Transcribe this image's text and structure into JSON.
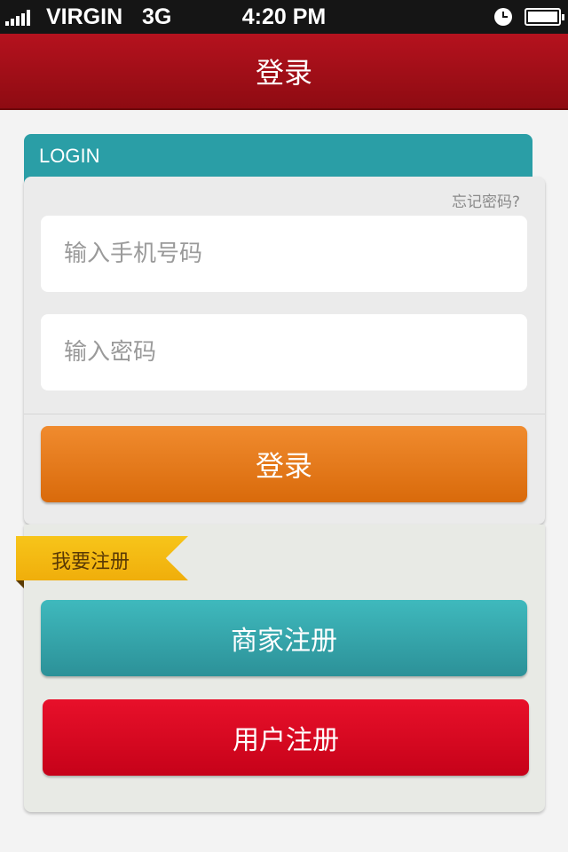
{
  "status_bar": {
    "carrier": "VIRGIN",
    "network": "3G",
    "time": "4:20 PM",
    "icons": [
      "signal-bars-icon",
      "clock-icon",
      "battery-icon"
    ]
  },
  "nav": {
    "title": "登录",
    "color": "#a90f19"
  },
  "login": {
    "tab_label": "LOGIN",
    "forgot_password": "忘记密码?",
    "phone_placeholder": "输入手机号码",
    "password_placeholder": "输入密码",
    "submit_label": "登录",
    "accent": "#2a9ea6",
    "button_color": "#e87a1e"
  },
  "register": {
    "ribbon_label": "我要注册",
    "merchant_label": "商家注册",
    "user_label": "用户注册",
    "merchant_color": "#35a8ad",
    "user_color": "#d9081f"
  }
}
